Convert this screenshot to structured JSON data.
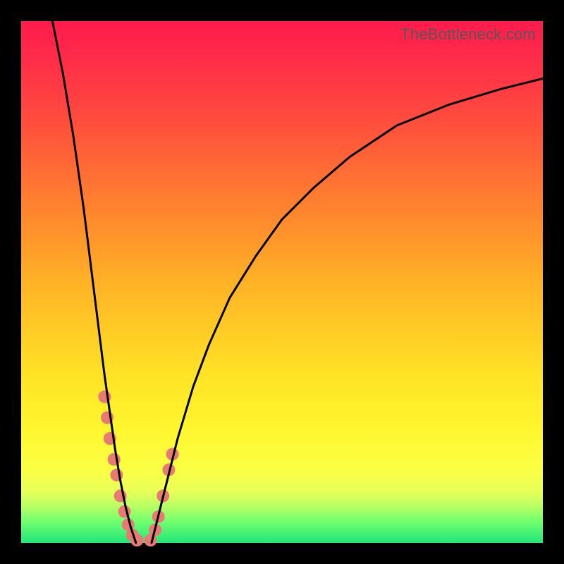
{
  "attribution": "TheBottleneck.com",
  "chart_data": {
    "type": "line",
    "title": "",
    "xlabel": "",
    "ylabel": "",
    "xlim": [
      0,
      100
    ],
    "ylim": [
      0,
      100
    ],
    "grid": false,
    "legend": false,
    "series": [
      {
        "name": "left-branch",
        "color": "#000000",
        "x": [
          6,
          8,
          10,
          12,
          14,
          15,
          16,
          17,
          18,
          19,
          20,
          21,
          22
        ],
        "y": [
          100,
          90,
          78,
          64,
          48,
          40,
          32,
          25,
          18,
          12,
          7,
          3,
          0
        ]
      },
      {
        "name": "right-branch",
        "color": "#000000",
        "x": [
          25,
          26,
          27,
          28,
          30,
          33,
          36,
          40,
          45,
          50,
          56,
          63,
          72,
          82,
          92,
          100
        ],
        "y": [
          0,
          4,
          8,
          12,
          20,
          30,
          38,
          47,
          55,
          62,
          68,
          74,
          80,
          84,
          87,
          89
        ]
      }
    ],
    "markers": {
      "name": "highlight-dots",
      "color": "#e77b74",
      "radius_px": 9,
      "points": [
        {
          "x": 16.0,
          "y": 28
        },
        {
          "x": 16.5,
          "y": 24
        },
        {
          "x": 17.0,
          "y": 20
        },
        {
          "x": 17.8,
          "y": 16
        },
        {
          "x": 18.3,
          "y": 13
        },
        {
          "x": 19.0,
          "y": 9
        },
        {
          "x": 19.8,
          "y": 6
        },
        {
          "x": 20.5,
          "y": 3.5
        },
        {
          "x": 21.3,
          "y": 1.5
        },
        {
          "x": 22.2,
          "y": 0.5
        },
        {
          "x": 24.8,
          "y": 0.5
        },
        {
          "x": 25.7,
          "y": 2.5
        },
        {
          "x": 26.3,
          "y": 5
        },
        {
          "x": 27.2,
          "y": 9
        },
        {
          "x": 28.3,
          "y": 14
        },
        {
          "x": 29.0,
          "y": 17
        }
      ]
    }
  }
}
